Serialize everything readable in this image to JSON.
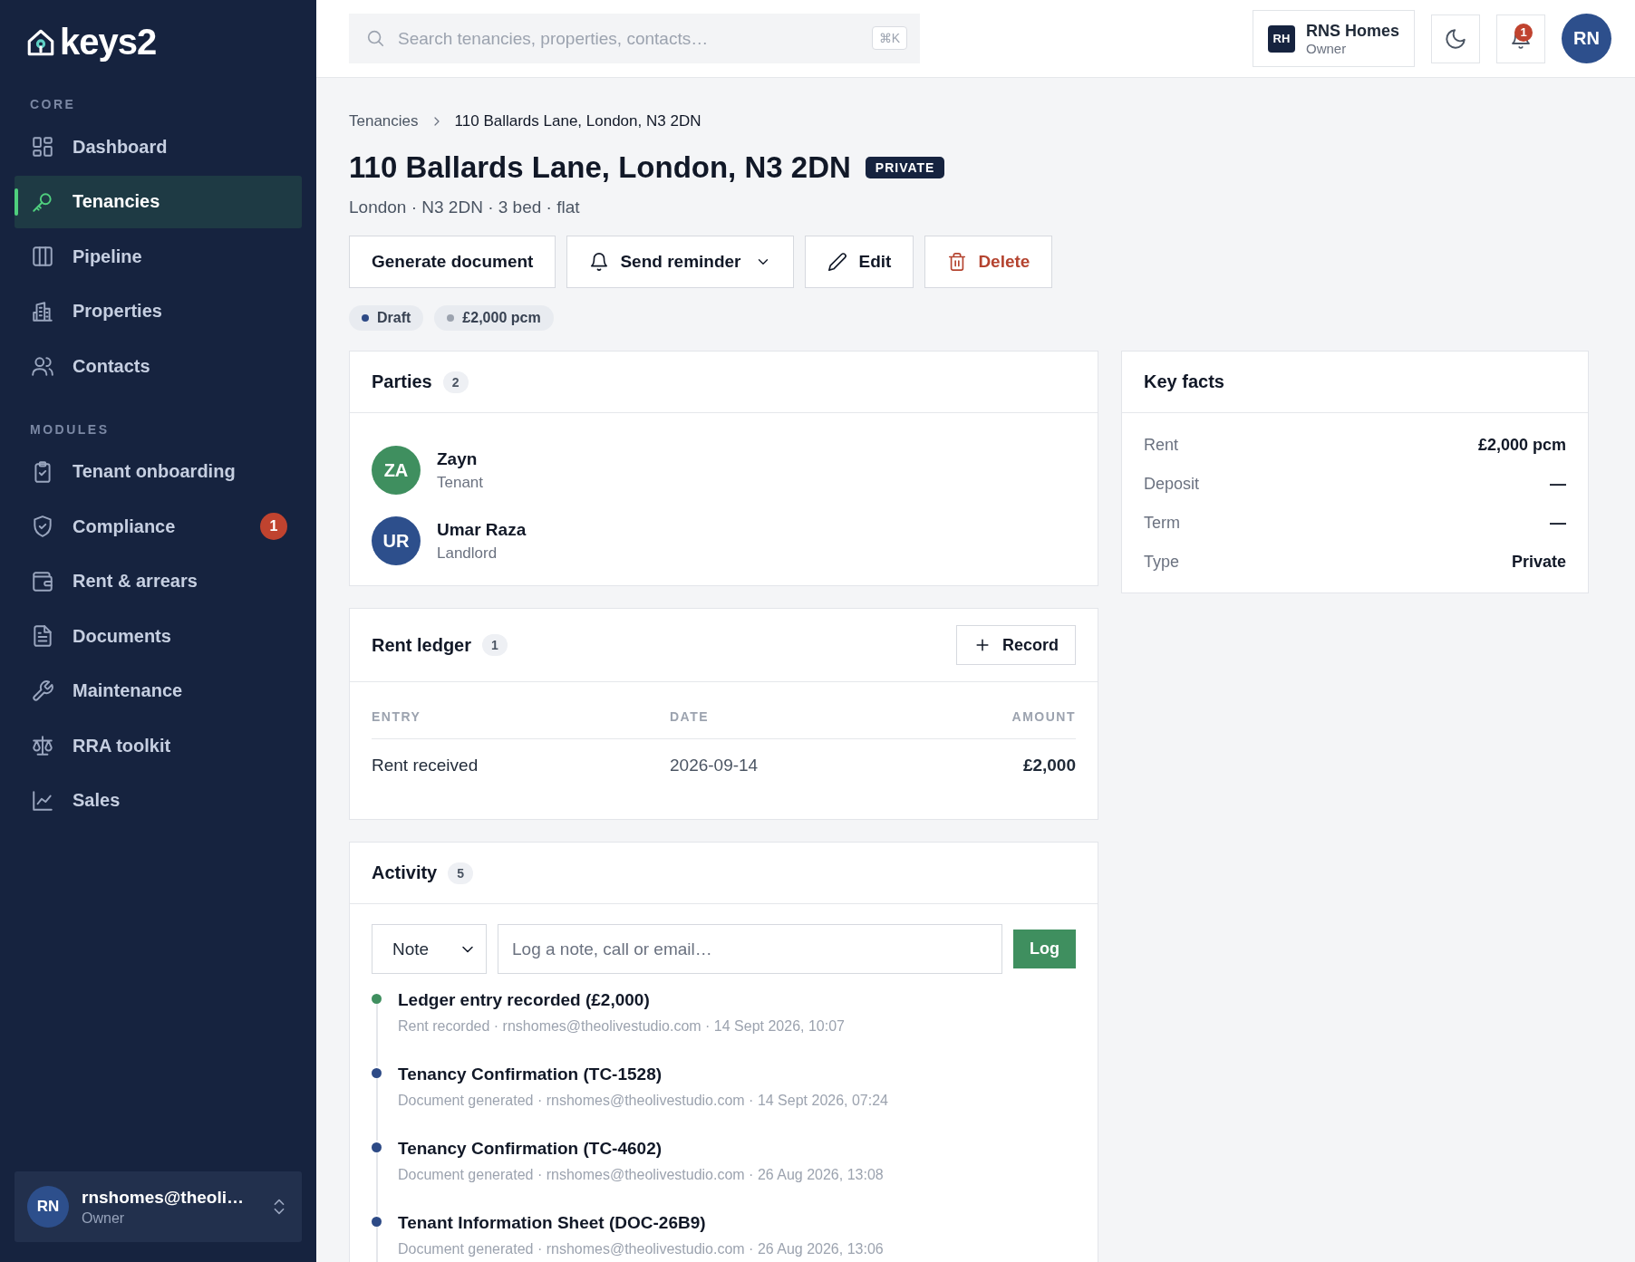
{
  "brand": {
    "name": "keys2"
  },
  "sidebar": {
    "sections": [
      {
        "label": "CORE",
        "items": [
          {
            "label": "Dashboard",
            "selected": false
          },
          {
            "label": "Tenancies",
            "selected": true
          },
          {
            "label": "Pipeline",
            "selected": false
          },
          {
            "label": "Properties",
            "selected": false
          },
          {
            "label": "Contacts",
            "selected": false
          }
        ]
      },
      {
        "label": "MODULES",
        "items": [
          {
            "label": "Tenant onboarding",
            "selected": false
          },
          {
            "label": "Compliance",
            "selected": false,
            "badge": "1"
          },
          {
            "label": "Rent & arrears",
            "selected": false
          },
          {
            "label": "Documents",
            "selected": false
          },
          {
            "label": "Maintenance",
            "selected": false
          },
          {
            "label": "RRA toolkit",
            "selected": false
          },
          {
            "label": "Sales",
            "selected": false
          }
        ]
      }
    ],
    "user": {
      "initials": "RN",
      "email": "rnshomes@theoli…",
      "role": "Owner"
    }
  },
  "topbar": {
    "search": {
      "placeholder": "Search tenancies, properties, contacts…",
      "shortcut": "⌘K"
    },
    "org": {
      "initials": "RH",
      "name": "RNS Homes",
      "role": "Owner"
    },
    "notifications": {
      "count": "1"
    },
    "avatar": {
      "initials": "RN"
    }
  },
  "breadcrumb": [
    "Tenancies",
    "110 Ballards Lane, London, N3 2DN"
  ],
  "title": "110 Ballards Lane, London, N3 2DN",
  "title_badge": "PRIVATE",
  "subtitle": "London · N3 2DN · 3 bed · flat",
  "actions": [
    {
      "label": "Generate document",
      "kind": "plain"
    },
    {
      "label": "Send reminder",
      "kind": "reminder"
    },
    {
      "label": "Edit",
      "kind": "edit"
    },
    {
      "label": "Delete",
      "kind": "delete"
    }
  ],
  "tags": [
    {
      "label": "Draft",
      "color": "#2d4a86"
    },
    {
      "label": "£2,000 pcm",
      "color": "#9ca3af"
    }
  ],
  "parties": {
    "title": "Parties",
    "count": "2",
    "items": [
      {
        "initials": "ZA",
        "name": "Zayn",
        "role": "Tenant",
        "color": "#3f8f5f"
      },
      {
        "initials": "UR",
        "name": "Umar Raza",
        "role": "Landlord",
        "color": "#2d4f8c"
      }
    ]
  },
  "key_facts": {
    "title": "Key facts",
    "rows": [
      {
        "label": "Rent",
        "value": "£2,000 pcm"
      },
      {
        "label": "Deposit",
        "value": "—"
      },
      {
        "label": "Term",
        "value": "—"
      },
      {
        "label": "Type",
        "value": "Private"
      }
    ]
  },
  "rent_ledger": {
    "title": "Rent ledger",
    "count": "1",
    "button": "Record",
    "columns": [
      "ENTRY",
      "DATE",
      "AMOUNT"
    ],
    "rows": [
      [
        "Rent received",
        "2026-09-14",
        "£2,000"
      ]
    ]
  },
  "activity": {
    "title": "Activity",
    "count": "5",
    "type_select": {
      "value": "Note"
    },
    "input": {
      "placeholder": "Log a note, call or email…"
    },
    "button": "Log",
    "items": [
      {
        "title": "Ledger entry recorded (£2,000)",
        "meta": "Rent recorded · rnshomes@theolivestudio.com · 14 Sept 2026, 10:07",
        "color": "#3f8f5f"
      },
      {
        "title": "Tenancy Confirmation (TC-1528)",
        "meta": "Document generated · rnshomes@theolivestudio.com · 14 Sept 2026, 07:24",
        "color": "#2d4a86"
      },
      {
        "title": "Tenancy Confirmation (TC-4602)",
        "meta": "Document generated · rnshomes@theolivestudio.com · 26 Aug 2026, 13:08",
        "color": "#2d4a86"
      },
      {
        "title": "Tenant Information Sheet (DOC-26B9)",
        "meta": "Document generated · rnshomes@theolivestudio.com · 26 Aug 2026, 13:06",
        "color": "#2d4a86"
      }
    ]
  }
}
